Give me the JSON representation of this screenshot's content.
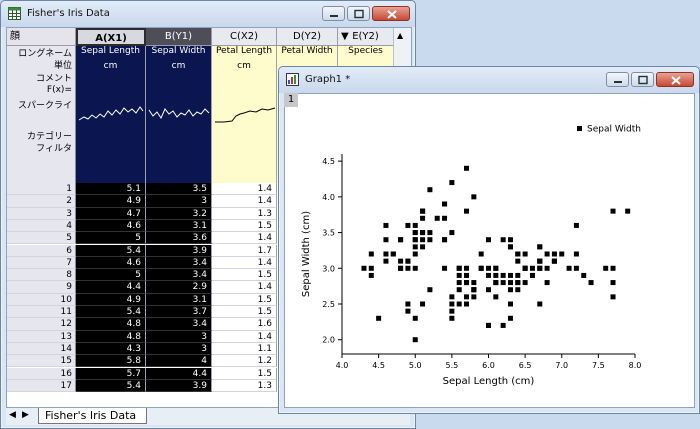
{
  "workbook": {
    "title": "Fisher's Iris Data",
    "corner_label": "顔",
    "columns": [
      {
        "header": "A(X1)",
        "long_name": "Sepal Length",
        "units": "cm"
      },
      {
        "header": "B(Y1)",
        "long_name": "Sepal Width",
        "units": "cm"
      },
      {
        "header": "C(X2)",
        "long_name": "Petal Length",
        "units": "cm"
      },
      {
        "header": "D(Y2)",
        "long_name": "Petal Width",
        "units": ""
      },
      {
        "header": "E(Y2)",
        "long_name": "Species",
        "units": ""
      }
    ],
    "row_labels": {
      "long_name": "ロングネーム",
      "units": "単位",
      "comments": "コメント",
      "fx": "F(x)=",
      "sparklines": "スパークライ",
      "category": "カテゴリー",
      "filter": "フィルタ"
    },
    "rows": [
      {
        "n": "1",
        "a": "5.1",
        "b": "3.5",
        "c": "1.4"
      },
      {
        "n": "2",
        "a": "4.9",
        "b": "3",
        "c": "1.4"
      },
      {
        "n": "3",
        "a": "4.7",
        "b": "3.2",
        "c": "1.3"
      },
      {
        "n": "4",
        "a": "4.6",
        "b": "3.1",
        "c": "1.5"
      },
      {
        "n": "5",
        "a": "5",
        "b": "3.6",
        "c": "1.4"
      },
      {
        "n": "6",
        "a": "5.4",
        "b": "3.9",
        "c": "1.7"
      },
      {
        "n": "7",
        "a": "4.6",
        "b": "3.4",
        "c": "1.4"
      },
      {
        "n": "8",
        "a": "5",
        "b": "3.4",
        "c": "1.5"
      },
      {
        "n": "9",
        "a": "4.4",
        "b": "2.9",
        "c": "1.4"
      },
      {
        "n": "10",
        "a": "4.9",
        "b": "3.1",
        "c": "1.5"
      },
      {
        "n": "11",
        "a": "5.4",
        "b": "3.7",
        "c": "1.5"
      },
      {
        "n": "12",
        "a": "4.8",
        "b": "3.4",
        "c": "1.6"
      },
      {
        "n": "13",
        "a": "4.8",
        "b": "3",
        "c": "1.4"
      },
      {
        "n": "14",
        "a": "4.3",
        "b": "3",
        "c": "1.1"
      },
      {
        "n": "15",
        "a": "5.8",
        "b": "4",
        "c": "1.2"
      },
      {
        "n": "16",
        "a": "5.7",
        "b": "4.4",
        "c": "1.5"
      },
      {
        "n": "17",
        "a": "5.4",
        "b": "3.9",
        "c": "1.3"
      }
    ],
    "sheet_tab": "Fisher's Iris Data"
  },
  "graph": {
    "title": "Graph1 *",
    "layer": "1"
  },
  "colors": {
    "selected_col_bg": "#000000",
    "header_bg": "#0b1650",
    "petal_yellow": "#fefccc"
  },
  "chart_data": {
    "type": "scatter",
    "xlabel": "Sepal Length (cm)",
    "ylabel": "Sepal Width (cm)",
    "xlim": [
      4.0,
      8.0
    ],
    "ylim": [
      1.8,
      4.6
    ],
    "xticks": [
      "4.0",
      "4.5",
      "5.0",
      "5.5",
      "6.0",
      "6.5",
      "7.0",
      "7.5",
      "8.0"
    ],
    "yticks": [
      "2.0",
      "2.5",
      "3.0",
      "3.5",
      "4.0",
      "4.5"
    ],
    "series": [
      {
        "name": "Sepal Width",
        "marker": "square",
        "color": "#000000",
        "points": [
          [
            5.1,
            3.5
          ],
          [
            4.9,
            3.0
          ],
          [
            4.7,
            3.2
          ],
          [
            4.6,
            3.1
          ],
          [
            5.0,
            3.6
          ],
          [
            5.4,
            3.9
          ],
          [
            4.6,
            3.4
          ],
          [
            5.0,
            3.4
          ],
          [
            4.4,
            2.9
          ],
          [
            4.9,
            3.1
          ],
          [
            5.4,
            3.7
          ],
          [
            4.8,
            3.4
          ],
          [
            4.8,
            3.0
          ],
          [
            4.3,
            3.0
          ],
          [
            5.8,
            4.0
          ],
          [
            5.7,
            4.4
          ],
          [
            5.4,
            3.9
          ],
          [
            5.1,
            3.5
          ],
          [
            5.7,
            3.8
          ],
          [
            5.1,
            3.8
          ],
          [
            5.4,
            3.4
          ],
          [
            5.1,
            3.7
          ],
          [
            4.6,
            3.6
          ],
          [
            5.1,
            3.3
          ],
          [
            4.8,
            3.4
          ],
          [
            5.0,
            3.0
          ],
          [
            5.0,
            3.4
          ],
          [
            5.2,
            3.5
          ],
          [
            5.2,
            3.4
          ],
          [
            4.7,
            3.2
          ],
          [
            4.8,
            3.1
          ],
          [
            5.4,
            3.4
          ],
          [
            5.2,
            4.1
          ],
          [
            5.5,
            4.2
          ],
          [
            4.9,
            3.1
          ],
          [
            5.0,
            3.2
          ],
          [
            5.5,
            3.5
          ],
          [
            4.9,
            3.6
          ],
          [
            4.4,
            3.0
          ],
          [
            5.1,
            3.4
          ],
          [
            5.0,
            3.5
          ],
          [
            4.5,
            2.3
          ],
          [
            4.4,
            3.2
          ],
          [
            5.0,
            3.5
          ],
          [
            5.1,
            3.8
          ],
          [
            4.8,
            3.0
          ],
          [
            5.1,
            3.8
          ],
          [
            4.6,
            3.2
          ],
          [
            5.3,
            3.7
          ],
          [
            5.0,
            3.3
          ],
          [
            7.0,
            3.2
          ],
          [
            6.4,
            3.2
          ],
          [
            6.9,
            3.1
          ],
          [
            5.5,
            2.3
          ],
          [
            6.5,
            2.8
          ],
          [
            5.7,
            2.8
          ],
          [
            6.3,
            3.3
          ],
          [
            4.9,
            2.4
          ],
          [
            6.6,
            2.9
          ],
          [
            5.2,
            2.7
          ],
          [
            5.0,
            2.0
          ],
          [
            5.9,
            3.0
          ],
          [
            6.0,
            2.2
          ],
          [
            6.1,
            2.9
          ],
          [
            5.6,
            2.9
          ],
          [
            6.7,
            3.1
          ],
          [
            5.6,
            3.0
          ],
          [
            5.8,
            2.7
          ],
          [
            6.2,
            2.2
          ],
          [
            5.6,
            2.5
          ],
          [
            5.9,
            3.2
          ],
          [
            6.1,
            2.8
          ],
          [
            6.3,
            2.5
          ],
          [
            6.1,
            2.8
          ],
          [
            6.4,
            2.9
          ],
          [
            6.6,
            3.0
          ],
          [
            6.8,
            2.8
          ],
          [
            6.7,
            3.0
          ],
          [
            6.0,
            2.9
          ],
          [
            5.7,
            2.6
          ],
          [
            5.5,
            2.4
          ],
          [
            5.8,
            2.7
          ],
          [
            6.0,
            2.7
          ],
          [
            5.4,
            3.0
          ],
          [
            6.0,
            3.4
          ],
          [
            6.7,
            3.1
          ],
          [
            6.3,
            2.3
          ],
          [
            5.6,
            3.0
          ],
          [
            5.5,
            2.5
          ],
          [
            5.5,
            2.6
          ],
          [
            6.1,
            3.0
          ],
          [
            5.8,
            2.6
          ],
          [
            5.0,
            2.3
          ],
          [
            5.6,
            2.7
          ],
          [
            5.7,
            3.0
          ],
          [
            5.7,
            2.9
          ],
          [
            6.2,
            2.9
          ],
          [
            5.1,
            2.5
          ],
          [
            5.7,
            2.8
          ],
          [
            6.3,
            3.3
          ],
          [
            5.8,
            2.7
          ],
          [
            7.1,
            3.0
          ],
          [
            6.3,
            2.9
          ],
          [
            6.5,
            3.0
          ],
          [
            7.6,
            3.0
          ],
          [
            4.9,
            2.5
          ],
          [
            7.3,
            2.9
          ],
          [
            6.7,
            2.5
          ],
          [
            7.2,
            3.6
          ],
          [
            6.5,
            3.2
          ],
          [
            6.4,
            2.7
          ],
          [
            6.8,
            3.0
          ],
          [
            5.7,
            2.5
          ],
          [
            5.8,
            2.8
          ],
          [
            6.4,
            3.2
          ],
          [
            6.5,
            3.0
          ],
          [
            7.7,
            3.8
          ],
          [
            7.7,
            2.6
          ],
          [
            6.0,
            2.2
          ],
          [
            6.9,
            3.2
          ],
          [
            5.6,
            2.8
          ],
          [
            7.7,
            2.8
          ],
          [
            6.3,
            2.7
          ],
          [
            6.7,
            3.3
          ],
          [
            7.2,
            3.2
          ],
          [
            6.2,
            2.8
          ],
          [
            6.1,
            3.0
          ],
          [
            6.4,
            2.8
          ],
          [
            7.2,
            3.0
          ],
          [
            7.4,
            2.8
          ],
          [
            7.9,
            3.8
          ],
          [
            6.4,
            2.8
          ],
          [
            6.3,
            2.8
          ],
          [
            6.1,
            2.6
          ],
          [
            7.7,
            3.0
          ],
          [
            6.3,
            3.4
          ],
          [
            6.4,
            3.1
          ],
          [
            6.0,
            3.0
          ],
          [
            6.9,
            3.1
          ],
          [
            6.7,
            3.1
          ],
          [
            6.9,
            3.1
          ],
          [
            6.8,
            3.2
          ],
          [
            6.7,
            3.3
          ],
          [
            6.7,
            3.0
          ],
          [
            6.3,
            2.5
          ],
          [
            6.5,
            3.0
          ],
          [
            6.2,
            3.4
          ],
          [
            5.9,
            3.0
          ]
        ]
      }
    ]
  }
}
